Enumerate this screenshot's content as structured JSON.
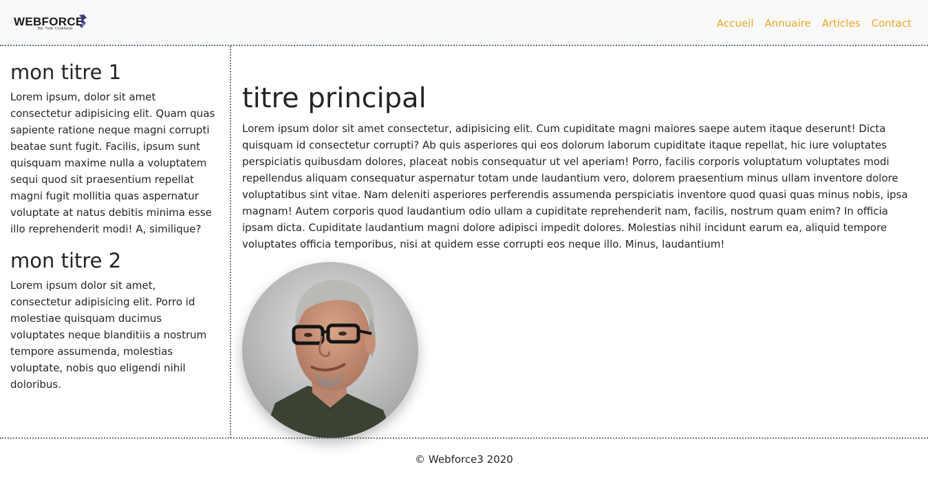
{
  "brand": {
    "name": "WEBFORCE",
    "tagline": "BE THE CHANGE",
    "logo_icon": "webforce-logo-icon"
  },
  "nav": {
    "links": [
      "Accueil",
      "Annuaire",
      "Articles",
      "Contact"
    ],
    "link_color": "#f0a81a"
  },
  "sidebar": {
    "sections": [
      {
        "title": "mon titre 1",
        "text": "Lorem ipsum, dolor sit amet consectetur adipisicing elit. Quam quas sapiente ratione neque magni corrupti beatae sunt fugit. Facilis, ipsum sunt quisquam maxime nulla a voluptatem sequi quod sit praesentium repellat magni fugit mollitia quas aspernatur voluptate at natus debitis minima esse illo reprehenderit modi! A, similique?"
      },
      {
        "title": "mon titre 2",
        "text": "Lorem ipsum dolor sit amet, consectetur adipisicing elit. Porro id molestiae quisquam ducimus voluptates neque blanditiis a nostrum tempore assumenda, molestias voluptate, nobis quo eligendi nihil doloribus."
      }
    ]
  },
  "main": {
    "title": "titre principal",
    "text": "Lorem ipsum dolor sit amet consectetur, adipisicing elit. Cum cupiditate magni maiores saepe autem itaque deserunt! Dicta quisquam id consectetur corrupti? Ab quis asperiores qui eos dolorum laborum cupiditate itaque repellat, hic iure voluptates perspiciatis quibusdam dolores, placeat nobis consequatur ut vel aperiam! Porro, facilis corporis voluptatum voluptates modi repellendus aliquam consequatur aspernatur totam unde laudantium vero, dolorem praesentium minus ullam inventore dolore voluptatibus sint vitae. Nam deleniti asperiores perferendis assumenda perspiciatis inventore quod quasi quas minus nobis, ipsa magnam! Autem corporis quod laudantium odio ullam a cupiditate reprehenderit nam, facilis, nostrum quam enim? In officia ipsam dicta. Cupiditate laudantium magni dolore adipisci impedit dolores. Molestias nihil incidunt earum ea, aliquid tempore voluptates officia temporibus, nisi at quidem esse corrupti eos neque illo. Minus, laudantium!",
    "image": "portrait-photo"
  },
  "footer": {
    "text": "© Webforce3 2020"
  }
}
